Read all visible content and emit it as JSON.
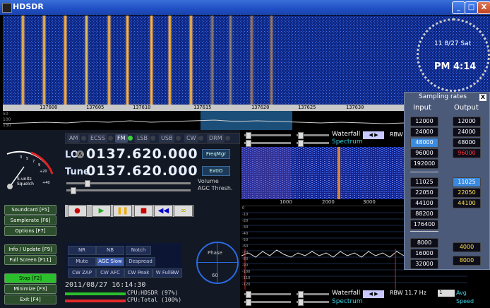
{
  "window": {
    "title": "HDSDR",
    "min": "_",
    "max": "□",
    "close": "X"
  },
  "clock": {
    "date": "11 8/27 Sat",
    "time": "PM 4:14"
  },
  "freq_axis": {
    "ticks": [
      "137600",
      "137605",
      "137610",
      "137615",
      "137620",
      "137625",
      "137630"
    ],
    "left_db": [
      "50",
      "100",
      "150"
    ]
  },
  "modes": [
    {
      "label": "AM",
      "active": false
    },
    {
      "label": "ECSS",
      "active": false
    },
    {
      "label": "FM",
      "active": true
    },
    {
      "label": "LSB",
      "active": false
    },
    {
      "label": "USB",
      "active": false
    },
    {
      "label": "CW",
      "active": false
    },
    {
      "label": "DRM",
      "active": false
    }
  ],
  "lo": {
    "label": "LO",
    "badge": "A",
    "value": "0137.620.000"
  },
  "tune": {
    "label": "Tune",
    "value": "0137.620.000"
  },
  "buttons": {
    "freqmgr": "FreqMgr",
    "extio": "ExtIO"
  },
  "labels": {
    "volume": "Volume",
    "agc": "AGC Thresh.",
    "smeter1": "S-units",
    "smeter2": "Squelch",
    "phase": "Phase",
    "phase_val": "60"
  },
  "smeter_scale": [
    "3",
    "5",
    "7",
    "9",
    "+20",
    "+40"
  ],
  "left_buttons": [
    {
      "label": "Soundcard   [F5]"
    },
    {
      "label": "Samplerate  [F6]"
    },
    {
      "label": "Options     [F7]"
    },
    {
      "label": "Info / Update  [F9]"
    },
    {
      "label": "Full Screen  [F11]"
    },
    {
      "label": "Stop        [F2]"
    },
    {
      "label": "Minimize    [F3]"
    },
    {
      "label": "Exit        [F4]"
    }
  ],
  "dsp": [
    "NR",
    "NB",
    "Notch",
    "Mute",
    "AGC Slow",
    "Despread",
    "CW ZAP",
    "CW AFC",
    "CW Peak",
    "W FullBW"
  ],
  "status": {
    "datetime": "2011/08/27 16:14:30",
    "cpu1": "CPU:HDSDR  (97%)",
    "cpu2": "CPU:Total   (100%)"
  },
  "controls": {
    "waterfall": "Waterfall",
    "spectrum": "Spectrum",
    "rbw": "RBW",
    "rbw_bottom": "RBW 11.7 Hz",
    "avg": "Avg",
    "speed": "Speed",
    "combo": "1"
  },
  "audio_axis": [
    "1000",
    "2000",
    "3000"
  ],
  "spec_db": [
    "0",
    "-10",
    "-20",
    "-30",
    "-40",
    "-50",
    "-60",
    "-70",
    "-80",
    "-90",
    "-100",
    "-110",
    "-120"
  ],
  "sampling": {
    "title": "Sampling rates",
    "close": "X",
    "input_header": "Input",
    "output_header": "Output",
    "input": [
      "12000",
      "24000",
      "48000",
      "96000",
      "192000"
    ],
    "output": [
      "12000",
      "24000",
      "48000",
      "96000"
    ],
    "input2": [
      "11025",
      "22050",
      "44100",
      "88200",
      "176400"
    ],
    "output2": [
      "11025",
      "22050",
      "44100"
    ],
    "input3": [
      "8000",
      "16000",
      "32000"
    ],
    "output3": [
      "4000",
      "8000"
    ]
  },
  "colors": {
    "accent": "#3a8ae0",
    "led_on": "#3dd13d",
    "titlebar": "#1f4fc4"
  }
}
